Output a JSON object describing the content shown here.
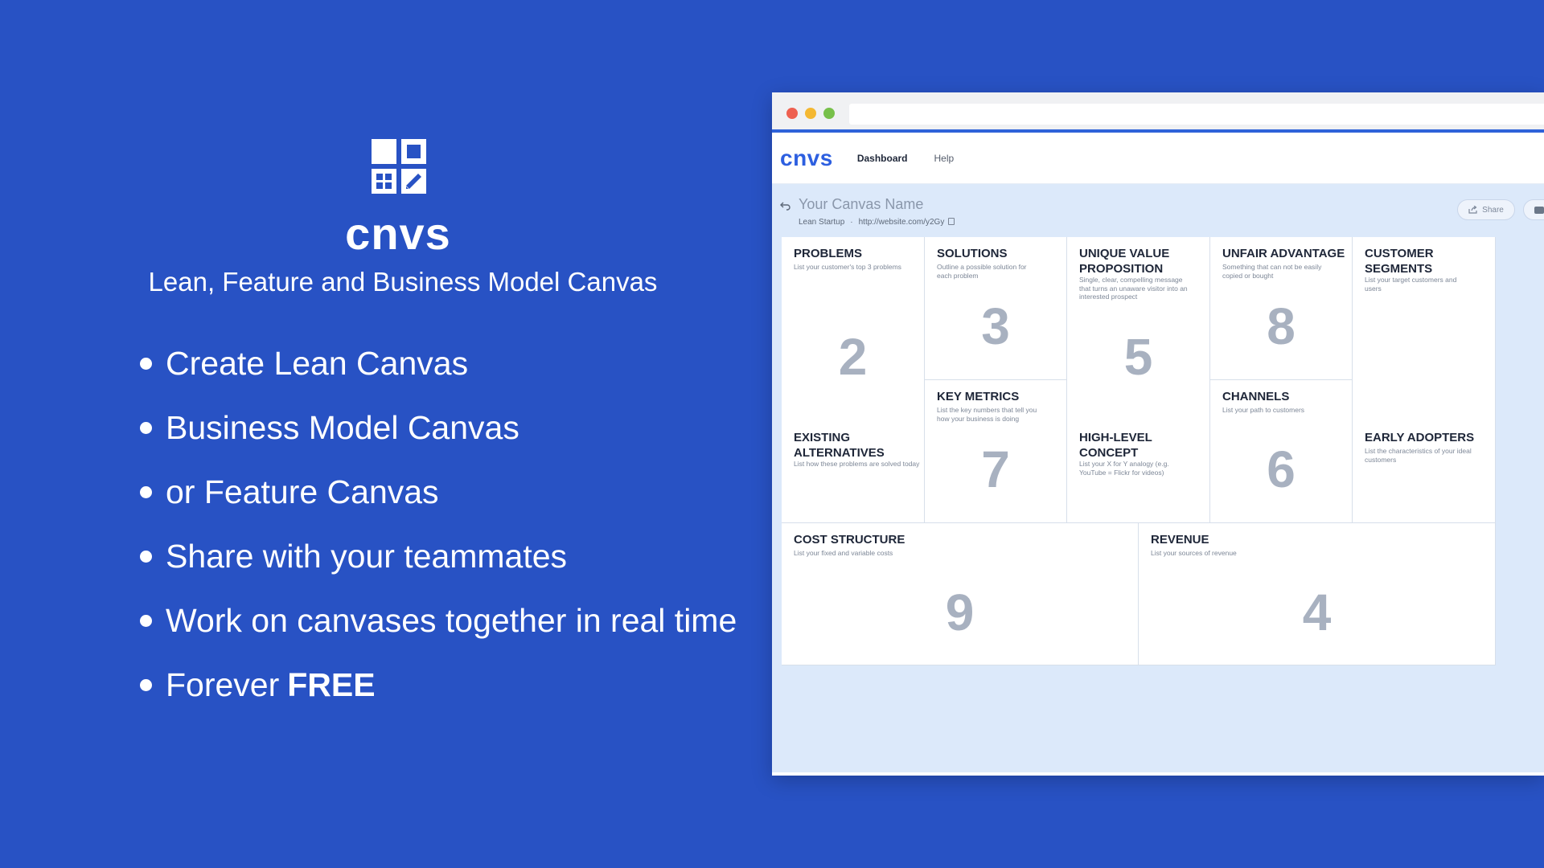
{
  "promo": {
    "brand": "cnvs",
    "tagline": "Lean, Feature and Business Model Canvas",
    "features": [
      "Create Lean Canvas",
      "Business Model Canvas",
      "or Feature Canvas",
      "Share with your teammates",
      "Work on canvases together in real time"
    ],
    "last_feature_prefix": "Forever",
    "last_feature_bold": "FREE"
  },
  "app": {
    "logo": "cnvs",
    "nav": {
      "dashboard": "Dashboard",
      "help": "Help"
    }
  },
  "canvas": {
    "name": "Your Canvas Name",
    "type": "Lean Startup",
    "separator": "·",
    "link": "http://website.com/y2Gy",
    "share_label": "Share"
  },
  "blocks": {
    "problems": {
      "title": "PROBLEMS",
      "desc": "List your customer's top 3 problems",
      "number": "2"
    },
    "existing_alternatives": {
      "title": "EXISTING ALTERNATIVES",
      "desc": "List how these problems are solved today"
    },
    "solutions": {
      "title": "SOLUTIONS",
      "desc": "Outline a possible solution for each problem",
      "number": "3"
    },
    "key_metrics": {
      "title": "KEY METRICS",
      "desc": "List the key numbers that tell you how your business is doing",
      "number": "7"
    },
    "uvp": {
      "title": "UNIQUE VALUE PROPOSITION",
      "desc": "Single, clear, compelling message that turns an unaware visitor into an interested prospect",
      "number": "5"
    },
    "high_level_concept": {
      "title": "HIGH-LEVEL CONCEPT",
      "desc": "List your X for Y analogy (e.g. YouTube = Flickr for videos)"
    },
    "unfair_advantage": {
      "title": "UNFAIR ADVANTAGE",
      "desc": "Something that can not be easily copied or bought",
      "number": "8"
    },
    "channels": {
      "title": "CHANNELS",
      "desc": "List your path to customers",
      "number": "6"
    },
    "customer_segments": {
      "title": "CUSTOMER SEGMENTS",
      "desc": "List your target customers and users"
    },
    "early_adopters": {
      "title": "EARLY ADOPTERS",
      "desc": "List the characteristics of your ideal customers"
    },
    "cost_structure": {
      "title": "COST STRUCTURE",
      "desc": "List your fixed and variable costs",
      "number": "9"
    },
    "revenue": {
      "title": "REVENUE",
      "desc": "List your sources of revenue",
      "number": "4"
    }
  },
  "colors": {
    "background": "#2852c4",
    "accent": "#2d5fe0",
    "canvas_bg": "#dce9fa",
    "number_gray": "#a8b1c0"
  },
  "icons": [
    "canvas-logo-icon",
    "back-arrow-icon",
    "copy-icon",
    "share-icon",
    "print-icon"
  ]
}
